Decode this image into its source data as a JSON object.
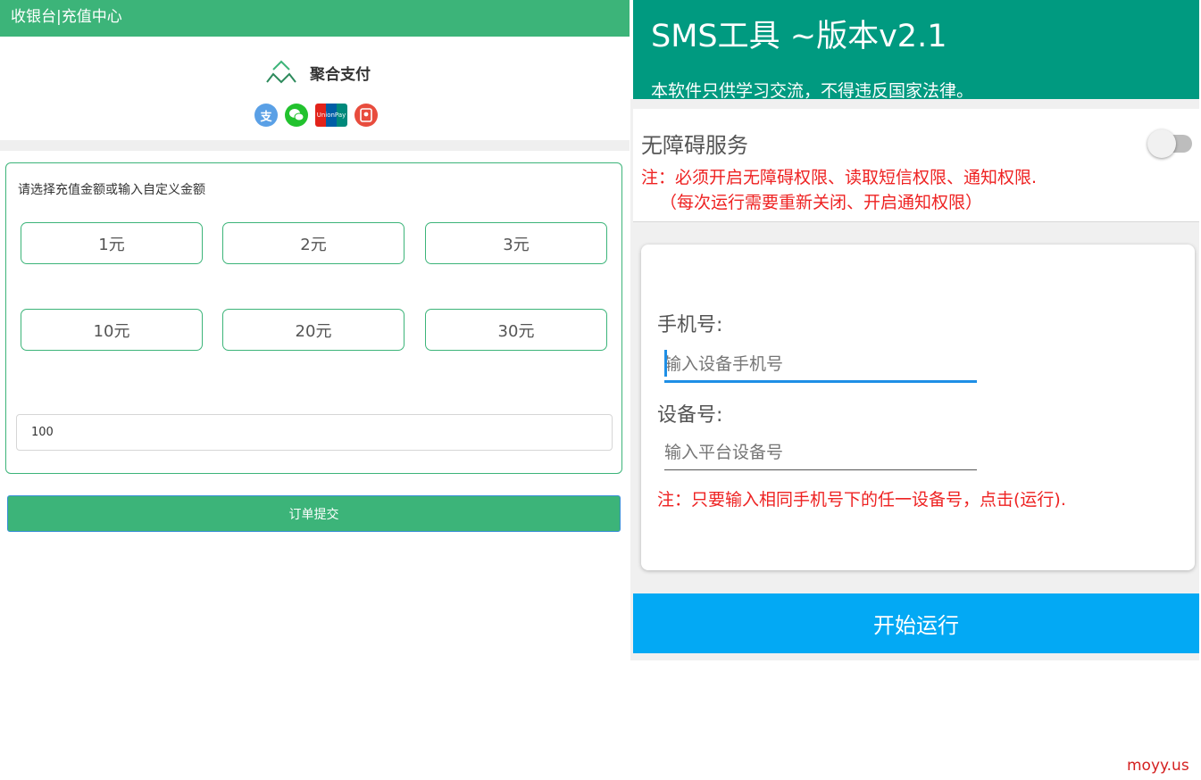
{
  "cashier": {
    "header_title": "收银台|充值中心",
    "brand_name": "聚合支付",
    "payment_methods": [
      {
        "icon": "alipay-icon",
        "glyph": "支",
        "color": "#5aa0e6"
      },
      {
        "icon": "wechat-pay-icon",
        "glyph": "",
        "color": "#22c22e"
      },
      {
        "icon": "unionpay-icon",
        "glyph": "UnionPay",
        "color": "#e2231a"
      },
      {
        "icon": "red-envelope-icon",
        "glyph": "",
        "color": "#e84c3d"
      }
    ],
    "amount_prompt": "请选择充值金额或输入自定义金额",
    "amount_options": [
      "1元",
      "2元",
      "3元",
      "10元",
      "20元",
      "30元"
    ],
    "custom_amount_value": "100",
    "submit_label": "订单提交",
    "accent_color": "#3cb479"
  },
  "sms_tool": {
    "title": "SMS工具 ~版本v2.1",
    "subtitle": "本软件只供学习交流，不得违反国家法律。",
    "accessibility_label": "无障碍服务",
    "accessibility_enabled": false,
    "permission_note_line1": "注：必须开启无障碍权限、读取短信权限、通知权限.",
    "permission_note_line2": "（每次运行需要重新关闭、开启通知权限）",
    "phone_label": "手机号:",
    "phone_placeholder": "输入设备手机号",
    "device_label": "设备号:",
    "device_placeholder": "输入平台设备号",
    "device_note": "注：只要输入相同手机号下的任一设备号，点击(运行).",
    "start_button": "开始运行",
    "appbar_color": "#009a80",
    "button_color": "#03a9f4"
  },
  "watermark": "moyy.us"
}
